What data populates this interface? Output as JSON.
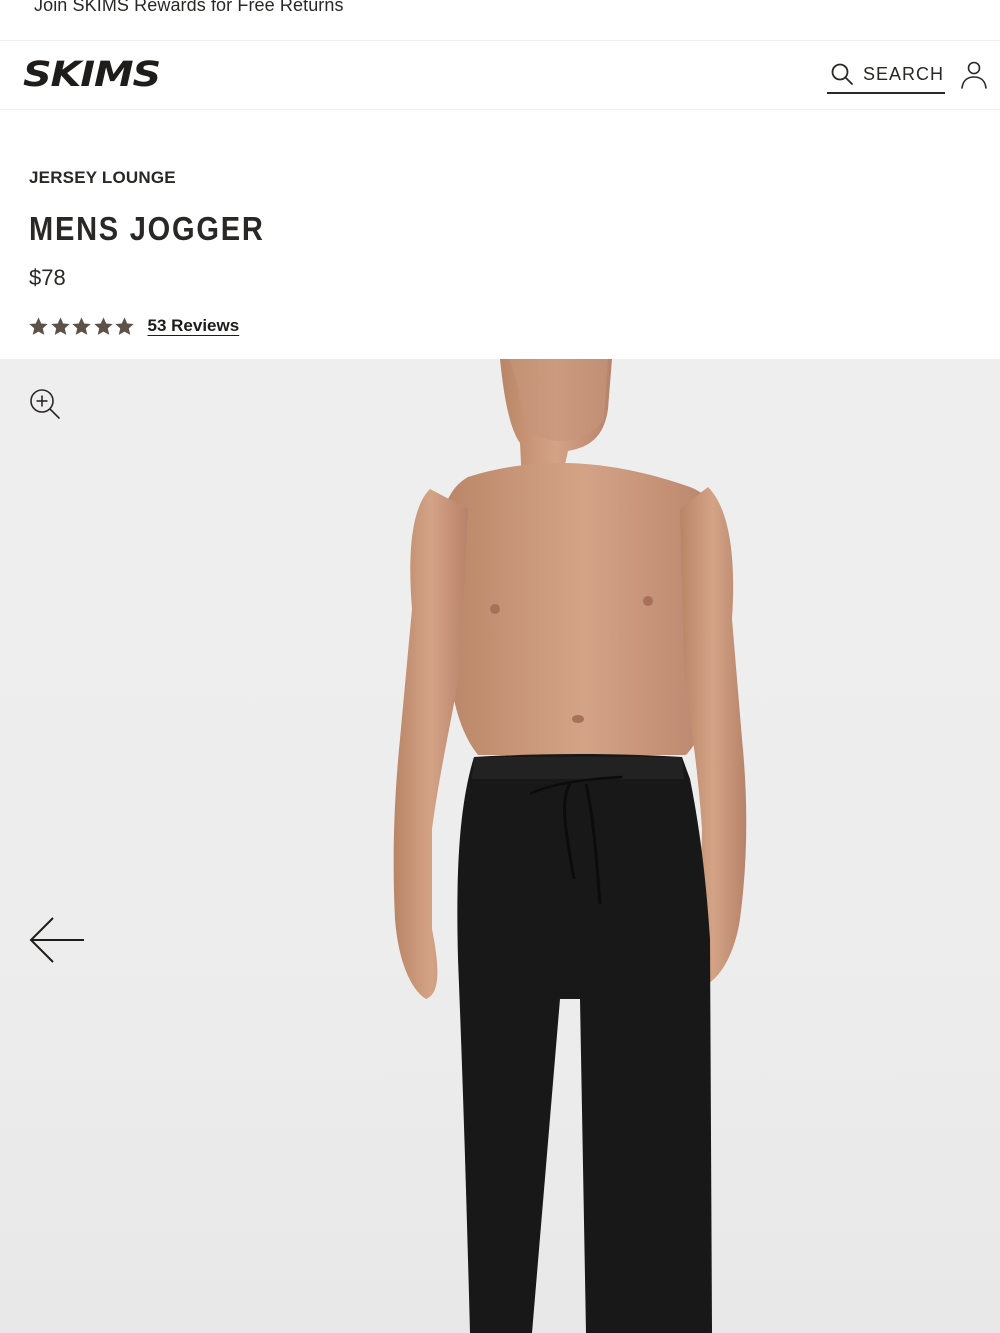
{
  "promo": {
    "text": "Join SKIMS Rewards for Free Returns"
  },
  "header": {
    "logo_text": "SKIMS",
    "search_label": "SEARCH",
    "icons": {
      "search": "search-icon",
      "account": "user-icon"
    }
  },
  "product": {
    "collection": "JERSEY LOUNGE",
    "title": "MENS JOGGER",
    "price": "$78",
    "rating": 5,
    "rating_max": 5,
    "reviews_label": "53 Reviews"
  },
  "gallery": {
    "icons": {
      "zoom": "zoom-in-icon",
      "previous": "arrow-left-icon"
    },
    "background_color": "#eeeeee"
  },
  "colors": {
    "text": "#2a2826",
    "star": "#5d524a",
    "pants": "#181818",
    "skin": "#c9987b"
  }
}
